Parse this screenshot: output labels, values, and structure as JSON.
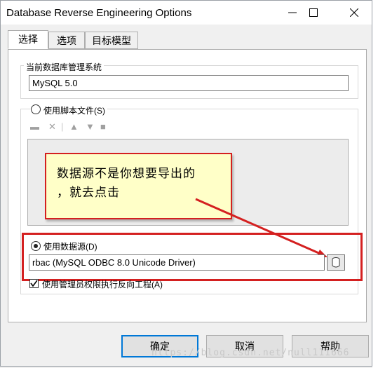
{
  "window": {
    "title": "Database Reverse Engineering Options"
  },
  "tabs": [
    {
      "label": "选择",
      "active": true
    },
    {
      "label": "选项"
    },
    {
      "label": "目标模型"
    }
  ],
  "dbms_group": {
    "label": "当前数据库管理系统",
    "value": "MySQL 5.0"
  },
  "script_option": {
    "label": "使用脚本文件(S)",
    "selected": false
  },
  "annotation": {
    "line1": "数据源不是你想要导出的",
    "line2": "，就去点击"
  },
  "datasource_option": {
    "label": "使用数据源(D)",
    "selected": true,
    "value": "rbac (MySQL ODBC 8.0 Unicode Driver)"
  },
  "admin_checkbox": {
    "label": "使用管理员权限执行反向工程(A)",
    "checked": true
  },
  "buttons": {
    "ok": "确定",
    "cancel": "取消",
    "help": "帮助"
  },
  "watermark": "https://blog.csdn.net/null111666",
  "colors": {
    "annotation_border": "#d42020",
    "annotation_fill": "#ffffc8",
    "default_button_border": "#0078d7"
  }
}
